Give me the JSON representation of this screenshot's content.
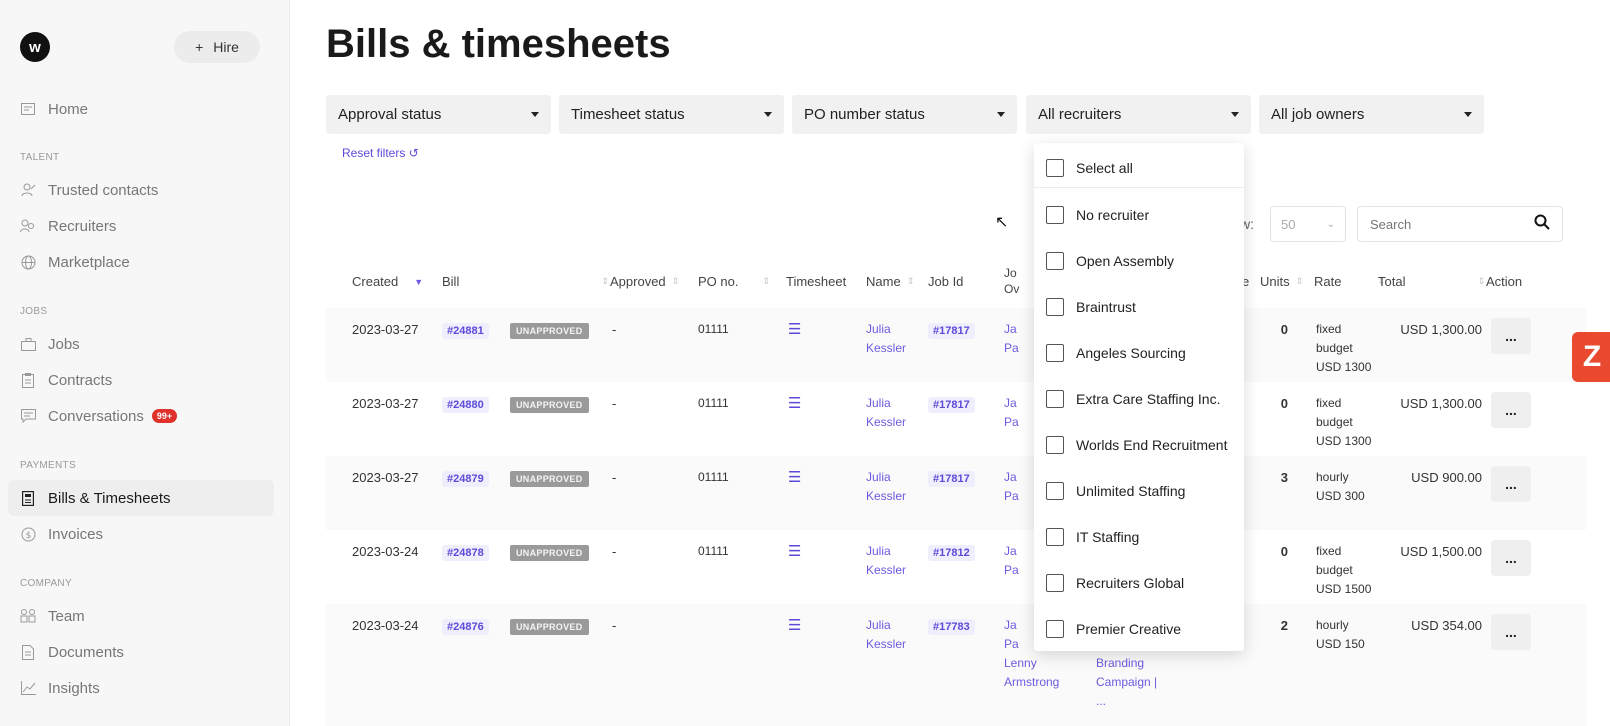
{
  "sidebar": {
    "logo": "w",
    "hire_label": "Hire",
    "items": [
      {
        "label": "Home",
        "icon": "home-icon",
        "section": ""
      },
      {
        "label": "Trusted contacts",
        "icon": "contacts-icon"
      },
      {
        "label": "Recruiters",
        "icon": "recruiters-icon"
      },
      {
        "label": "Marketplace",
        "icon": "globe-icon"
      },
      {
        "label": "Jobs",
        "icon": "briefcase-icon"
      },
      {
        "label": "Contracts",
        "icon": "contract-icon"
      },
      {
        "label": "Conversations",
        "icon": "chat-icon",
        "badge": "99+"
      },
      {
        "label": "Bills & Timesheets",
        "icon": "bill-icon",
        "active": true
      },
      {
        "label": "Invoices",
        "icon": "dollar-icon"
      },
      {
        "label": "Team",
        "icon": "team-icon"
      },
      {
        "label": "Documents",
        "icon": "document-icon"
      },
      {
        "label": "Insights",
        "icon": "chart-icon"
      }
    ],
    "sections": {
      "talent": "TALENT",
      "jobs": "JOBS",
      "payments": "PAYMENTS",
      "company": "COMPANY"
    }
  },
  "header": {
    "title": "Bills & timesheets"
  },
  "filters": {
    "approval": "Approval status",
    "timesheet": "Timesheet status",
    "po": "PO number status",
    "recruiters": "All recruiters",
    "job_owners": "All job owners",
    "reset": "Reset filters"
  },
  "controls": {
    "show_label": "w:",
    "show_value": "50",
    "search_placeholder": "Search"
  },
  "table": {
    "columns": {
      "created": "Created",
      "bill": "Bill",
      "approved": "Approved",
      "po": "PO no.",
      "timesheet": "Timesheet",
      "name": "Name",
      "jobid": "Job Id",
      "jobowner_1": "Jo",
      "jobowner_2": "Ov",
      "hidden": "e",
      "units": "Units",
      "rate": "Rate",
      "total": "Total",
      "action": "Action"
    },
    "rows": [
      {
        "created": "2023-03-27",
        "bill": "#24881",
        "status": "UNAPPROVED",
        "approved": "-",
        "po": "01111",
        "name_1": "Julia",
        "name_2": "Kessler",
        "jobid": "#17817",
        "owner_1": "Ja",
        "owner_2": "Pa",
        "units": "0",
        "rate_1": "fixed",
        "rate_2": "budget",
        "rate_3": "USD 1300",
        "total": "USD 1,300.00"
      },
      {
        "created": "2023-03-27",
        "bill": "#24880",
        "status": "UNAPPROVED",
        "approved": "-",
        "po": "01111",
        "name_1": "Julia",
        "name_2": "Kessler",
        "jobid": "#17817",
        "owner_1": "Ja",
        "owner_2": "Pa",
        "units": "0",
        "rate_1": "fixed",
        "rate_2": "budget",
        "rate_3": "USD 1300",
        "total": "USD 1,300.00"
      },
      {
        "created": "2023-03-27",
        "bill": "#24879",
        "status": "UNAPPROVED",
        "approved": "-",
        "po": "01111",
        "name_1": "Julia",
        "name_2": "Kessler",
        "jobid": "#17817",
        "owner_1": "Ja",
        "owner_2": "Pa",
        "units": "3",
        "rate_1": "hourly",
        "rate_2": "USD 300",
        "rate_3": "",
        "total": "USD 900.00"
      },
      {
        "created": "2023-03-24",
        "bill": "#24878",
        "status": "UNAPPROVED",
        "approved": "-",
        "po": "01111",
        "name_1": "Julia",
        "name_2": "Kessler",
        "jobid": "#17812",
        "owner_1": "Ja",
        "owner_2": "Pa",
        "units": "0",
        "rate_1": "fixed",
        "rate_2": "budget",
        "rate_3": "USD 1500",
        "total": "USD 1,500.00"
      },
      {
        "created": "2023-03-24",
        "bill": "#24876",
        "status": "UNAPPROVED",
        "approved": "-",
        "po": "",
        "name_1": "Julia",
        "name_2": "Kessler",
        "jobid": "#17783",
        "owner_1": "Ja",
        "owner_2": "Pa",
        "owner_3": "Lenny",
        "owner_4": "Armstrong",
        "job_1": "Branding",
        "job_2": "Campaign |",
        "job_3": "...",
        "units": "2",
        "rate_1": "hourly",
        "rate_2": "USD 150",
        "rate_3": "",
        "total": "USD 354.00"
      }
    ],
    "action_label": "..."
  },
  "recruiter_dropdown": {
    "options": [
      "Select all",
      "No recruiter",
      "Open Assembly",
      "Braintrust",
      "Angeles Sourcing",
      "Extra Care Staffing Inc.",
      "Worlds End Recruitment",
      "Unlimited Staffing",
      "IT Staffing",
      "Recruiters Global",
      "Premier Creative"
    ]
  },
  "widget": {
    "label": "Z"
  },
  "colors": {
    "accent": "#5b4bd8",
    "badge": "#e0312b",
    "widget": "#e8492f"
  }
}
